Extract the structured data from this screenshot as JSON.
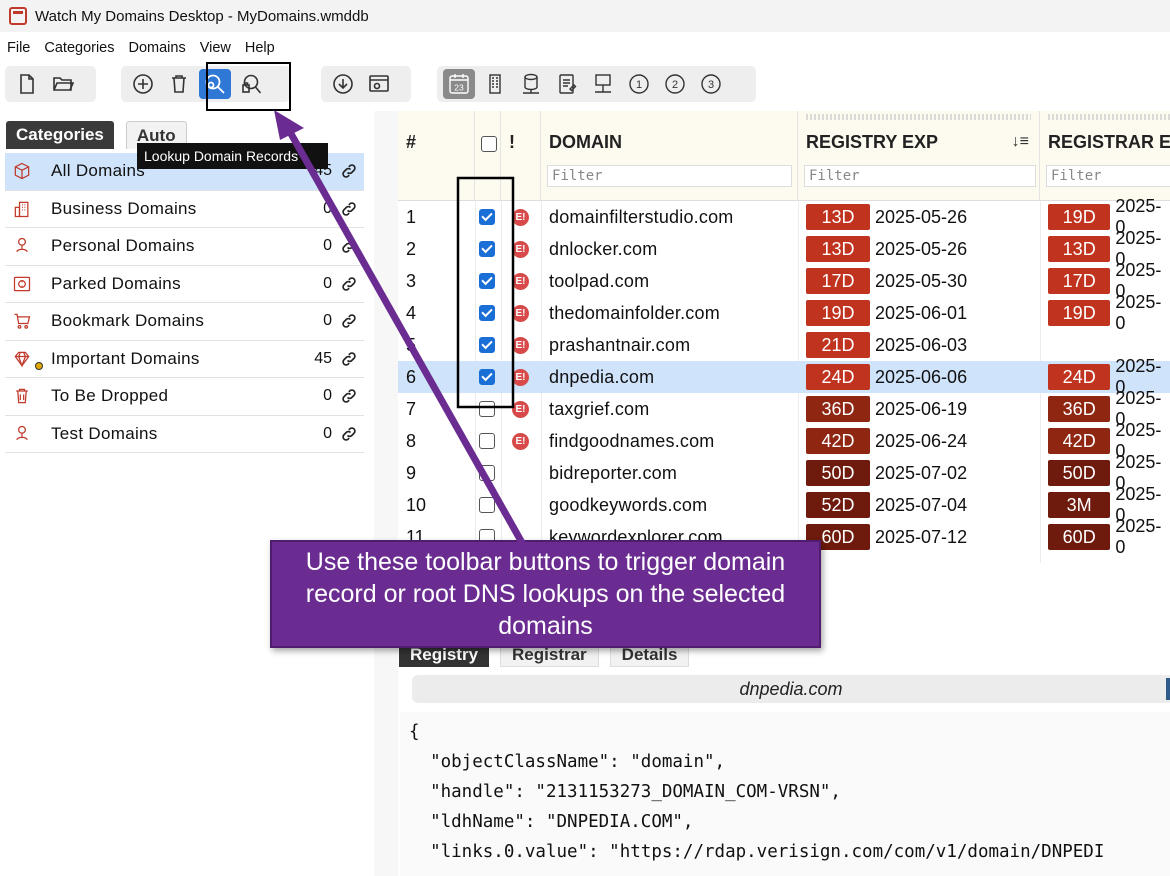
{
  "window": {
    "title": "Watch My Domains Desktop - MyDomains.wmddb"
  },
  "menu": [
    "File",
    "Categories",
    "Domains",
    "View",
    "Help"
  ],
  "toolbar": {
    "groups": [
      [
        "new-file-icon",
        "open-folder-icon"
      ],
      [
        "add-icon",
        "delete-icon",
        "lookup-domain-records-icon",
        "lookup-root-dns-icon"
      ],
      [
        "download-icon",
        "settings-window-icon"
      ],
      [
        "calendar-23-icon",
        "building-icon",
        "database-icon",
        "notes-icon",
        "network-icon",
        "view-1-icon",
        "view-2-icon",
        "view-3-icon"
      ]
    ],
    "numbers": [
      "1",
      "2",
      "3"
    ],
    "calendar_day": "23",
    "tooltip": "Lookup Domain Records"
  },
  "left_tabs": {
    "categories": "Categories",
    "auto": "Auto"
  },
  "categories": [
    {
      "label": "All Domains",
      "count": "45",
      "icon": "cube-icon"
    },
    {
      "label": "Business Domains",
      "count": "0",
      "icon": "building-icon"
    },
    {
      "label": "Personal Domains",
      "count": "0",
      "icon": "person-icon"
    },
    {
      "label": "Parked Domains",
      "count": "0",
      "icon": "safe-icon"
    },
    {
      "label": "Bookmark Domains",
      "count": "0",
      "icon": "cart-icon"
    },
    {
      "label": "Important Domains",
      "count": "45",
      "icon": "diamond-icon"
    },
    {
      "label": "To Be Dropped",
      "count": "0",
      "icon": "trash-icon"
    },
    {
      "label": "Test Domains",
      "count": "0",
      "icon": "person-icon"
    }
  ],
  "table": {
    "headers": {
      "num": "#",
      "warn": "!",
      "domain": "DOMAIN",
      "registry_exp": "REGISTRY EXP",
      "registrar_exp": "REGISTRAR E"
    },
    "filter_placeholder": "Filter",
    "rows": [
      {
        "num": "1",
        "checked": true,
        "warn": "E!",
        "domain": "domainfilterstudio.com",
        "reg_badge": "13D",
        "reg_date": "2025-05-26",
        "rar_badge": "19D",
        "rar_date": "2025-0"
      },
      {
        "num": "2",
        "checked": true,
        "warn": "E!",
        "domain": "dnlocker.com",
        "reg_badge": "13D",
        "reg_date": "2025-05-26",
        "rar_badge": "13D",
        "rar_date": "2025-0"
      },
      {
        "num": "3",
        "checked": true,
        "warn": "E!",
        "domain": "toolpad.com",
        "reg_badge": "17D",
        "reg_date": "2025-05-30",
        "rar_badge": "17D",
        "rar_date": "2025-0"
      },
      {
        "num": "4",
        "checked": true,
        "warn": "E!",
        "domain": "thedomainfolder.com",
        "reg_badge": "19D",
        "reg_date": "2025-06-01",
        "rar_badge": "19D",
        "rar_date": "2025-0"
      },
      {
        "num": "5",
        "checked": true,
        "warn": "E!",
        "domain": "prashantnair.com",
        "reg_badge": "21D",
        "reg_date": "2025-06-03",
        "rar_badge": "",
        "rar_date": ""
      },
      {
        "num": "6",
        "checked": true,
        "warn": "E!",
        "domain": "dnpedia.com",
        "reg_badge": "24D",
        "reg_date": "2025-06-06",
        "rar_badge": "24D",
        "rar_date": "2025-0"
      },
      {
        "num": "7",
        "checked": false,
        "warn": "E!",
        "domain": "taxgrief.com",
        "reg_badge": "36D",
        "reg_date": "2025-06-19",
        "rar_badge": "36D",
        "rar_date": "2025-0"
      },
      {
        "num": "8",
        "checked": false,
        "warn": "E!",
        "domain": "findgoodnames.com",
        "reg_badge": "42D",
        "reg_date": "2025-06-24",
        "rar_badge": "42D",
        "rar_date": "2025-0"
      },
      {
        "num": "9",
        "checked": false,
        "warn": "",
        "domain": "bidreporter.com",
        "reg_badge": "50D",
        "reg_date": "2025-07-02",
        "rar_badge": "50D",
        "rar_date": "2025-0"
      },
      {
        "num": "10",
        "checked": false,
        "warn": "",
        "domain": "goodkeywords.com",
        "reg_badge": "52D",
        "reg_date": "2025-07-04",
        "rar_badge": "3M",
        "rar_date": "2025-0"
      },
      {
        "num": "11",
        "checked": false,
        "warn": "",
        "domain": "keywordexplorer.com",
        "reg_badge": "60D",
        "reg_date": "2025-07-12",
        "rar_badge": "60D",
        "rar_date": "2025-0"
      }
    ],
    "selected_row": 5
  },
  "badge_colors": {
    "red": "#c0331f",
    "dark": "#8e2612",
    "darker": "#6e1a0c"
  },
  "callout": "Use these toolbar buttons to trigger domain record or root DNS lookups on the selected domains",
  "detail": {
    "tabs": [
      "Registry",
      "Registrar",
      "Details"
    ],
    "domain": "dnpedia.com",
    "json_lines": [
      "{",
      "  \"objectClassName\": \"domain\",",
      "  \"handle\": \"2131153273_DOMAIN_COM-VRSN\",",
      "  \"ldhName\": \"DNPEDIA.COM\",",
      "  \"links.0.value\": \"https://rdap.verisign.com/com/v1/domain/DNPEDI"
    ]
  }
}
